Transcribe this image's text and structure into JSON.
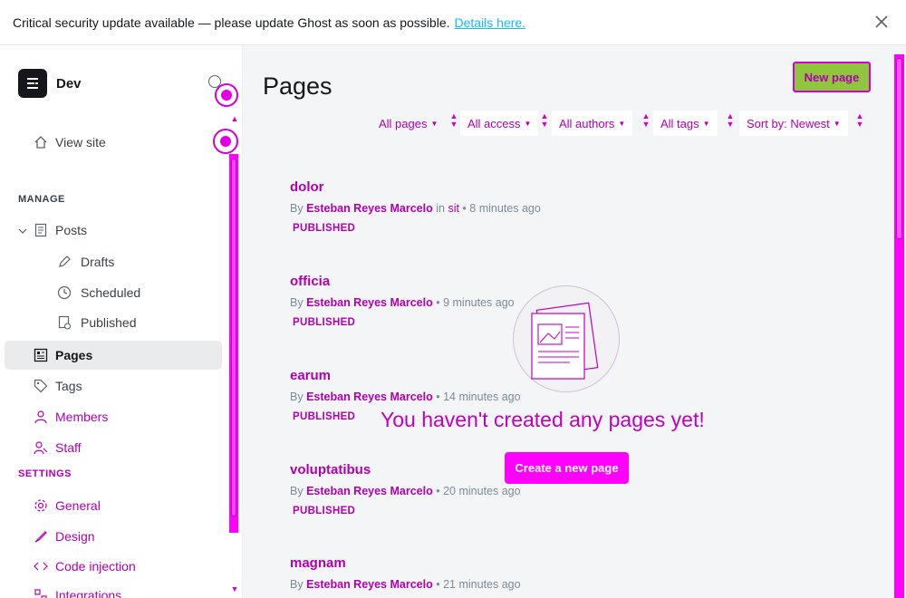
{
  "banner": {
    "message": "Critical security update available — please update Ghost as soon as possible.",
    "link": "Details here."
  },
  "sidebar": {
    "site_name": "Dev",
    "view_site": "View site",
    "manage_label": "MANAGE",
    "posts": "Posts",
    "drafts": "Drafts",
    "scheduled": "Scheduled",
    "published": "Published",
    "pages": "Pages",
    "tags": "Tags",
    "members": "Members",
    "staff": "Staff",
    "settings_label": "SETTINGS",
    "general": "General",
    "design": "Design",
    "code_injection": "Code injection",
    "integrations": "Integrations"
  },
  "main": {
    "title": "Pages",
    "new_page_button": "New page",
    "filters": {
      "all_pages": "All pages",
      "all_access": "All access",
      "all_authors": "All authors",
      "all_tags": "All tags",
      "sort": "Sort by: Newest"
    },
    "pages": [
      {
        "title": "dolor",
        "by": "By",
        "author": "Esteban Reyes Marcelo",
        "in_label": "in",
        "tag": "sit",
        "time": "8 minutes ago",
        "status": "PUBLISHED"
      },
      {
        "title": "officia",
        "by": "By",
        "author": "Esteban Reyes Marcelo",
        "in_label": "",
        "tag": "",
        "time": "9 minutes ago",
        "status": "PUBLISHED"
      },
      {
        "title": "earum",
        "by": "By",
        "author": "Esteban Reyes Marcelo",
        "in_label": "",
        "tag": "",
        "time": "14 minutes ago",
        "status": "PUBLISHED"
      },
      {
        "title": "voluptatibus",
        "by": "By",
        "author": "Esteban Reyes Marcelo",
        "in_label": "",
        "tag": "",
        "time": "20 minutes ago",
        "status": "PUBLISHED"
      },
      {
        "title": "magnam",
        "by": "By",
        "author": "Esteban Reyes Marcelo",
        "in_label": "",
        "tag": "",
        "time": "21 minutes ago",
        "status": ""
      }
    ],
    "empty_state": "You haven't created any pages yet!",
    "create_button": "Create a new page"
  },
  "colors": {
    "accent": "#14b8ff",
    "primary_button": "#8fc63e",
    "artifact_magenta": "#ff00ff"
  },
  "icons": {
    "close": "close-icon",
    "logo": "ghost-logo-icon",
    "home": "home-icon",
    "posts": "document-icon",
    "drafts": "pencil-icon",
    "scheduled": "clock-icon",
    "published": "published-icon",
    "pages": "pages-icon",
    "tags": "tag-icon",
    "members": "members-icon",
    "staff": "staff-icon",
    "general": "gear-icon",
    "design": "brush-icon",
    "code_injection": "code-icon"
  }
}
